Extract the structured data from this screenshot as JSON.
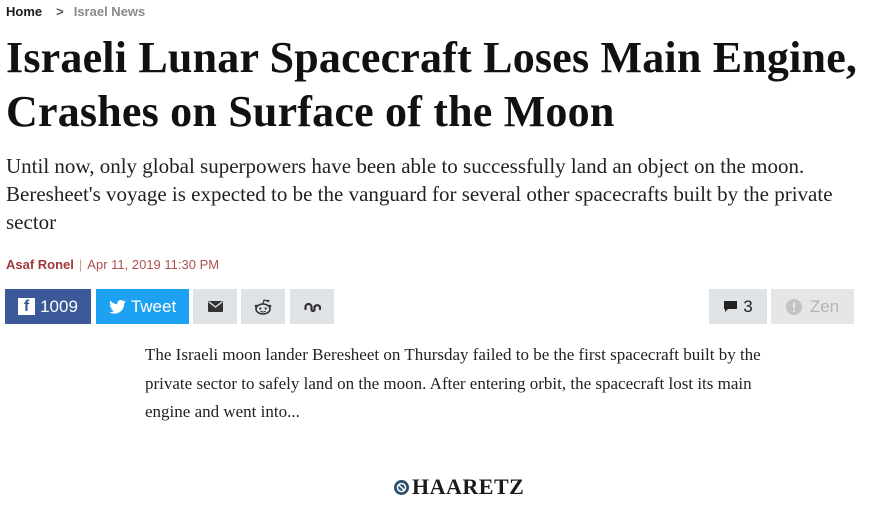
{
  "breadcrumb": {
    "home": "Home",
    "separator": ">",
    "section": "Israel News"
  },
  "article": {
    "headline": "Israeli Lunar Spacecraft Loses Main Engine, Crashes on Surface of the Moon",
    "subheadline": "Until now, only global superpowers have been able to successfully land an object on the moon. Beresheet's voyage is expected to be the vanguard for several other spacecrafts built by the private sector",
    "author": "Asaf Ronel",
    "byline_separator": "|",
    "date": "Apr 11, 2019 11:30 PM",
    "body": "The Israeli moon lander Beresheet on Thursday failed to be the first spacecraft built by the private sector to safely land on the moon. After entering orbit, the spacecraft lost its main engine and went into..."
  },
  "share": {
    "facebook_count": "1009",
    "tweet_label": "Tweet",
    "comments_count": "3",
    "zen_label": "Zen",
    "icons": {
      "facebook": "facebook-icon",
      "twitter": "twitter-bird-icon",
      "email": "envelope-icon",
      "reddit": "reddit-icon",
      "stumbleupon": "stumbleupon-icon",
      "comments": "speech-bubble-icon",
      "zen": "info-circle-icon"
    }
  },
  "footer": {
    "logo_text": "HAARETZ"
  },
  "colors": {
    "facebook": "#3b5998",
    "twitter": "#1da1f2",
    "share_grey": "#dfe3e6",
    "byline_red": "#a13a3a"
  }
}
